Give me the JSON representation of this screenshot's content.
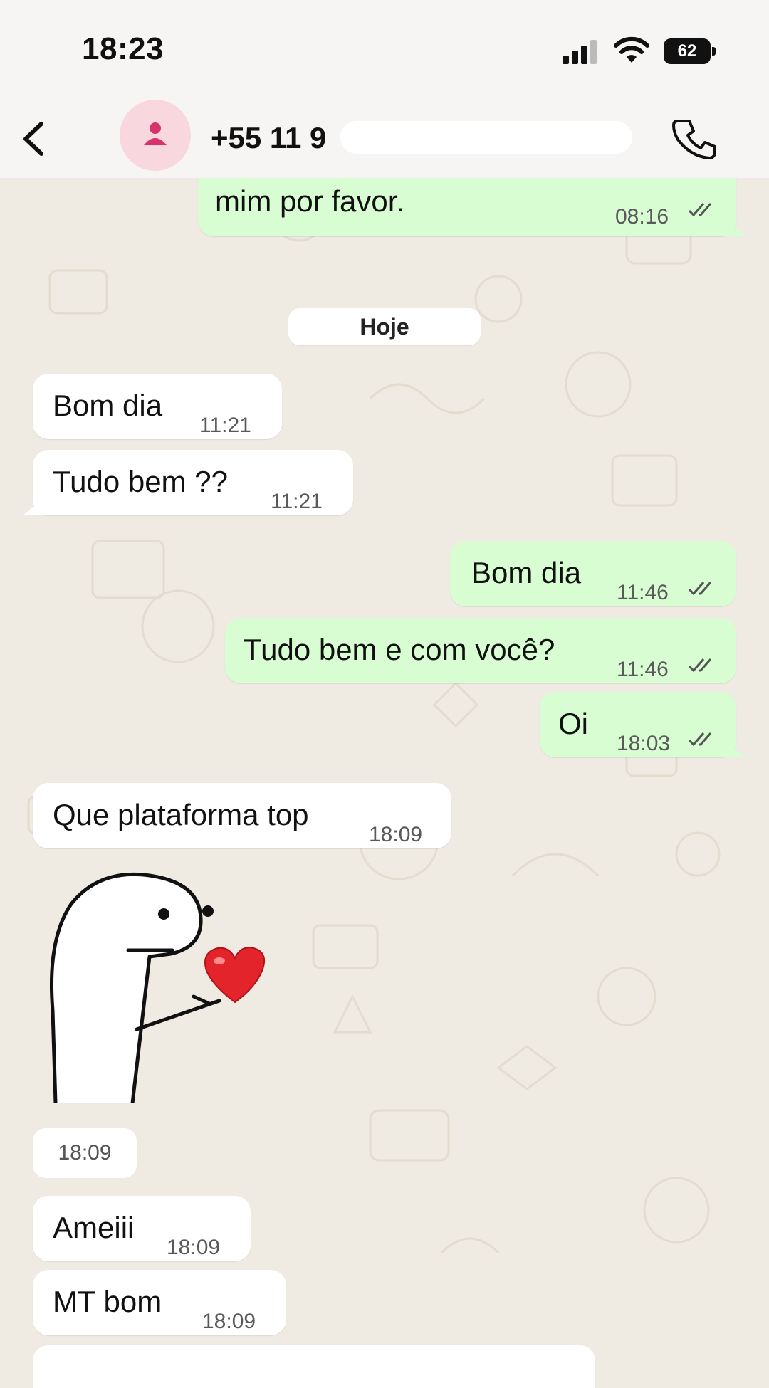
{
  "status_bar": {
    "time": "18:23",
    "battery": "62"
  },
  "header": {
    "contact": "+55 11 9"
  },
  "date_separator": "Hoje",
  "messages": [
    {
      "direction": "out",
      "text": "mim por favor.",
      "time": "08:16",
      "status": "read"
    },
    {
      "direction": "in",
      "text": "Bom dia",
      "time": "11:21"
    },
    {
      "direction": "in",
      "text": "Tudo bem ??",
      "time": "11:21"
    },
    {
      "direction": "out",
      "text": "Bom dia",
      "time": "11:46",
      "status": "read"
    },
    {
      "direction": "out",
      "text": "Tudo bem e com você?",
      "time": "11:46",
      "status": "read"
    },
    {
      "direction": "out",
      "text": "Oi",
      "time": "18:03",
      "status": "read"
    },
    {
      "direction": "in",
      "text": "Que plataforma top",
      "time": "18:09"
    },
    {
      "direction": "in",
      "type": "sticker",
      "sticker": "heart-character-sticker",
      "time": "18:09"
    },
    {
      "direction": "in",
      "text": "Ameiii",
      "time": "18:09"
    },
    {
      "direction": "in",
      "text": "MT bom",
      "time": "18:09"
    }
  ],
  "colors": {
    "incoming_bubble": "#ffffff",
    "outgoing_bubble": "#d9fdd3",
    "wallpaper": "#efeae2",
    "avatar_bg": "#f9d7df",
    "avatar_icon": "#d6336c"
  }
}
